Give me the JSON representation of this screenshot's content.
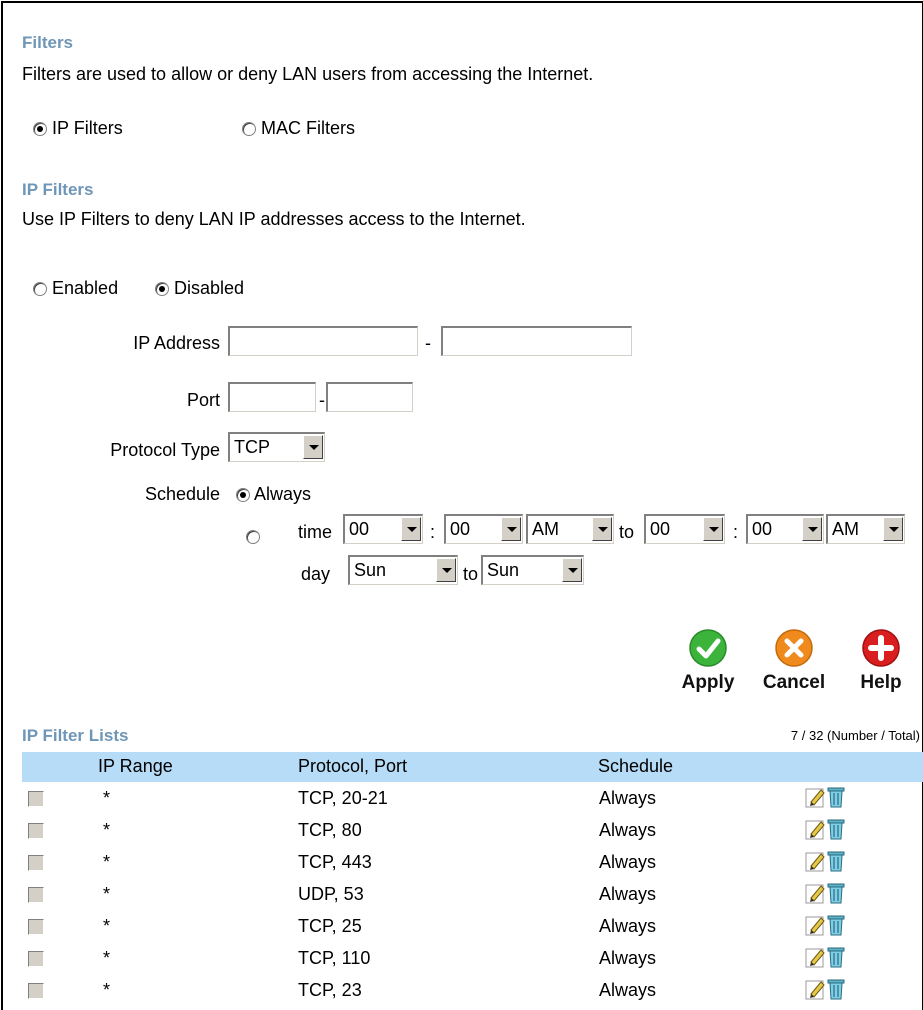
{
  "filters": {
    "title": "Filters",
    "description": "Filters are used to allow or deny LAN users from accessing the Internet.",
    "ip_filters_label": "IP Filters",
    "mac_filters_label": "MAC Filters",
    "selected": "IP Filters"
  },
  "ip_filters": {
    "title": "IP Filters",
    "description": "Use IP Filters to deny LAN IP addresses access to the Internet.",
    "enabled_label": "Enabled",
    "disabled_label": "Disabled",
    "state": "Disabled",
    "ip_address_label": "IP Address",
    "ip_start": "",
    "ip_end": "",
    "ip_separator": "-",
    "port_label": "Port",
    "port_start": "",
    "port_end": "",
    "port_separator": "-",
    "protocol_label": "Protocol Type",
    "protocol_value": "TCP",
    "schedule_label": "Schedule",
    "always_label": "Always",
    "schedule_selected": "Always",
    "time_label": "time",
    "time_from_hour": "00",
    "time_from_min": "00",
    "time_from_ampm": "AM",
    "time_colon": ":",
    "to_label": "to",
    "time_to_hour": "00",
    "time_to_min": "00",
    "time_to_ampm": "AM",
    "day_label": "day",
    "day_from": "Sun",
    "day_to": "Sun"
  },
  "actions": {
    "apply": "Apply",
    "cancel": "Cancel",
    "help": "Help"
  },
  "list": {
    "title": "IP Filter Lists",
    "count": "7 / 32 (Number / Total)",
    "columns": [
      "IP Range",
      "Protocol, Port",
      "Schedule"
    ],
    "rows": [
      {
        "range": "*",
        "protocol": "TCP, 20-21",
        "schedule": "Always"
      },
      {
        "range": "*",
        "protocol": "TCP, 80",
        "schedule": "Always"
      },
      {
        "range": "*",
        "protocol": "TCP, 443",
        "schedule": "Always"
      },
      {
        "range": "*",
        "protocol": "UDP, 53",
        "schedule": "Always"
      },
      {
        "range": "*",
        "protocol": "TCP, 25",
        "schedule": "Always"
      },
      {
        "range": "*",
        "protocol": "TCP, 110",
        "schedule": "Always"
      },
      {
        "range": "*",
        "protocol": "TCP, 23",
        "schedule": "Always"
      }
    ]
  },
  "colors": {
    "section_title": "#6f96b6",
    "table_header": "#b7dcf7",
    "apply_green": "#3cb43c",
    "cancel_orange": "#f08a1c",
    "help_red": "#d81e1e"
  }
}
